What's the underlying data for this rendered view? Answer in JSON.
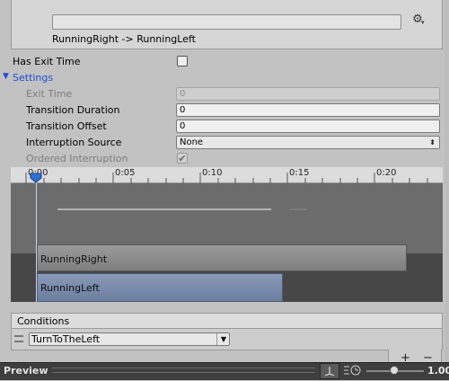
{
  "header": {
    "name_value": "",
    "transition_label": "RunningRight -> RunningLeft",
    "gear_icon": "gear-icon"
  },
  "settings": {
    "has_exit_time_label": "Has Exit Time",
    "has_exit_time_checked": false,
    "foldout_label": "Settings",
    "exit_time_label": "Exit Time",
    "exit_time_value": "0",
    "transition_duration_label": "Transition Duration",
    "transition_duration_value": "0",
    "transition_offset_label": "Transition Offset",
    "transition_offset_value": "0",
    "interruption_source_label": "Interruption Source",
    "interruption_source_value": "None",
    "ordered_interruption_label": "Ordered Interruption",
    "ordered_interruption_checked": true
  },
  "timeline": {
    "ticks": [
      "0:00",
      "0:05",
      "0:10",
      "0:15",
      "0:20"
    ],
    "bar_from_label": "RunningRight",
    "bar_to_label": "RunningLeft"
  },
  "conditions": {
    "header_label": "Conditions",
    "parameter_value": "TurnToTheLeft",
    "add_label": "+",
    "remove_label": "−"
  },
  "preview": {
    "title": "Preview",
    "speed_value": "1.00"
  },
  "colors": {
    "selected_bar": "#7a8cab",
    "foldout": "#1f4fd1"
  }
}
